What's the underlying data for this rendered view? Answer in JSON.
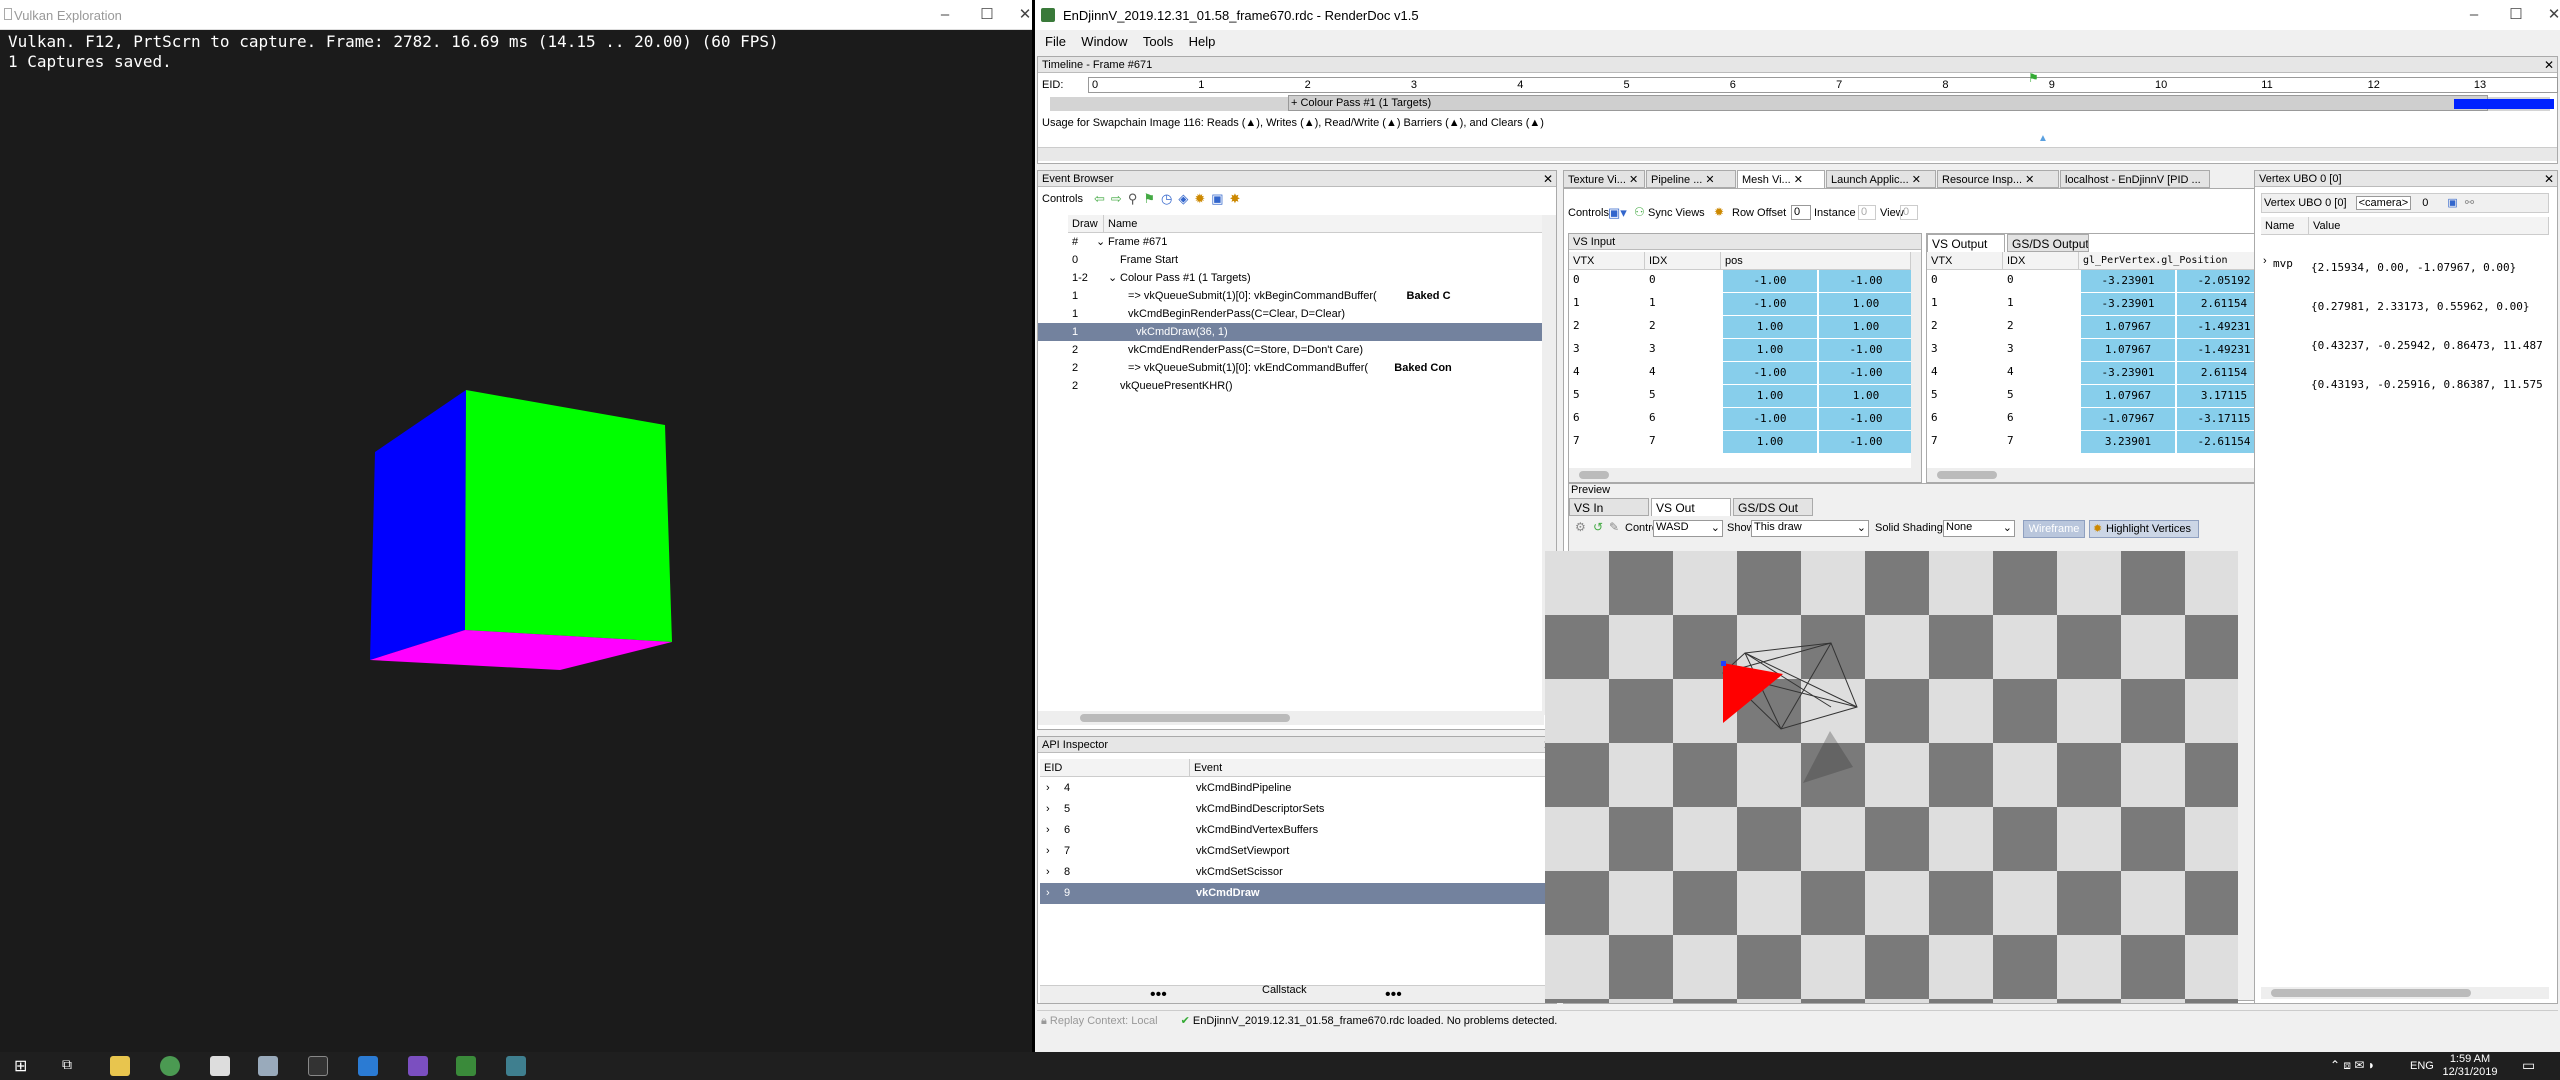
{
  "vulkan": {
    "title": "Vulkan Exploration",
    "overlay_line1": "Vulkan. F12, PrtScrn to capture. Frame: 2782. 16.69 ms (14.15 .. 20.00) (60 FPS)",
    "overlay_line2": "1 Captures saved."
  },
  "renderdoc": {
    "title": "EnDjinnV_2019.12.31_01.58_frame670.rdc - RenderDoc v1.5",
    "menu": [
      "File",
      "Window",
      "Tools",
      "Help"
    ],
    "timeline": {
      "title": "Timeline - Frame #671",
      "eid_label": "EID:",
      "ticks": [
        "0",
        "1",
        "2",
        "3",
        "4",
        "5",
        "6",
        "7",
        "8",
        "9",
        "10",
        "11",
        "12",
        "13"
      ],
      "pass": "+ Colour Pass #1 (1 Targets)",
      "usage": "Usage for Swapchain Image 116: Reads (▲), Writes (▲), Read/Write (▲) Barriers (▲), and Clears (▲)"
    },
    "event_browser": {
      "title": "Event Browser",
      "controls": "Controls",
      "col_draw": "Draw #",
      "col_name": "Name",
      "rows": [
        {
          "d": "",
          "n": "Frame #671"
        },
        {
          "d": "0",
          "n": "Frame Start"
        },
        {
          "d": "1-2",
          "n": "Colour Pass #1 (1 Targets)"
        },
        {
          "d": "1",
          "n": "=> vkQueueSubmit(1)[0]: vkBeginCommandBuffer(",
          "b": "Baked C"
        },
        {
          "d": "1",
          "n": "vkCmdBeginRenderPass(C=Clear, D=Clear)"
        },
        {
          "d": "1",
          "n": "vkCmdDraw(36, 1)"
        },
        {
          "d": "2",
          "n": "vkCmdEndRenderPass(C=Store, D=Don't Care)"
        },
        {
          "d": "2",
          "n": "=> vkQueueSubmit(1)[0]: vkEndCommandBuffer(",
          "b": "Baked Con"
        },
        {
          "d": "2",
          "n": "vkQueuePresentKHR()"
        }
      ]
    },
    "api_inspector": {
      "title": "API Inspector",
      "col_eid": "EID",
      "col_event": "Event",
      "rows": [
        {
          "e": "4",
          "n": "vkCmdBindPipeline"
        },
        {
          "e": "5",
          "n": "vkCmdBindDescriptorSets"
        },
        {
          "e": "6",
          "n": "vkCmdBindVertexBuffers"
        },
        {
          "e": "7",
          "n": "vkCmdSetViewport"
        },
        {
          "e": "8",
          "n": "vkCmdSetScissor"
        },
        {
          "e": "9",
          "n": "vkCmdDraw"
        }
      ],
      "callstack": "Callstack"
    },
    "tabs": [
      "Texture Vi...",
      "Pipeline ...",
      "Mesh Vi...",
      "Launch Applic...",
      "Resource Insp...",
      "localhost - EnDjinnV [PID ..."
    ],
    "mesh": {
      "controls": "Controls",
      "sync": "Sync Views",
      "row_offset": "Row Offset",
      "row_offset_val": "0",
      "instance": "Instance",
      "instance_val": "0",
      "view": "View",
      "view_val": "0",
      "vs_input": "VS Input",
      "vs_output": "VS Output",
      "gsds_output": "GS/DS Output",
      "in_cols": [
        "VTX",
        "IDX",
        "pos"
      ],
      "out_cols": [
        "VTX",
        "IDX",
        "gl_PerVertex.gl_Position"
      ],
      "in_rows": [
        [
          "0",
          "0",
          "-1.00",
          "-1.00"
        ],
        [
          "1",
          "1",
          "-1.00",
          "1.00"
        ],
        [
          "2",
          "2",
          "1.00",
          "1.00"
        ],
        [
          "3",
          "3",
          "1.00",
          "-1.00"
        ],
        [
          "4",
          "4",
          "-1.00",
          "-1.00"
        ],
        [
          "5",
          "5",
          "1.00",
          "1.00"
        ],
        [
          "6",
          "6",
          "-1.00",
          "-1.00"
        ],
        [
          "7",
          "7",
          "1.00",
          "-1.00"
        ]
      ],
      "out_rows": [
        [
          "0",
          "0",
          "-3.23901",
          "-2.05192"
        ],
        [
          "1",
          "1",
          "-3.23901",
          "2.61154"
        ],
        [
          "2",
          "2",
          "1.07967",
          "-1.49231"
        ],
        [
          "3",
          "3",
          "1.07967",
          "-1.49231"
        ],
        [
          "4",
          "4",
          "-3.23901",
          "2.61154"
        ],
        [
          "5",
          "5",
          "1.07967",
          "3.17115"
        ],
        [
          "6",
          "6",
          "-1.07967",
          "-3.17115"
        ],
        [
          "7",
          "7",
          "3.23901",
          "-2.61154"
        ]
      ],
      "preview": "Preview",
      "ptabs": [
        "VS In",
        "VS Out",
        "GS/DS Out"
      ],
      "controls_label": "Controls",
      "controls_val": "WASD",
      "show_label": "Show",
      "show_val": "This draw",
      "shading_label": "Solid Shading",
      "shading_val": "None",
      "wireframe": "Wireframe",
      "highlight": "Highlight Vertices"
    },
    "ubo": {
      "title": "Vertex UBO 0 [0]",
      "header": "Vertex UBO 0 [0]",
      "cam": "<camera>",
      "num": "0",
      "col_name": "Name",
      "col_value": "Value",
      "name": "mvp",
      "values": [
        "{2.15934, 0.00, -1.07967, 0.00}",
        "{0.27981, 2.33173, 0.55962, 0.00}",
        "{0.43237, -0.25942, 0.86473, 11.487",
        "{0.43193, -0.25916, 0.86387, 11.575"
      ]
    },
    "status": {
      "replay": "Replay Context: Local",
      "msg": "EnDjinnV_2019.12.31_01.58_frame670.rdc loaded. No problems detected."
    }
  },
  "taskbar": {
    "lang": "ENG",
    "time": "1:59 AM",
    "date": "12/31/2019"
  },
  "colors": {
    "selection": "#73829e",
    "vertex_cell": "#87ceeb",
    "cube_blue": "#0000ff",
    "cube_green": "#00ff00",
    "cube_magenta": "#ff00ff",
    "triangle_red": "#ff0000"
  }
}
